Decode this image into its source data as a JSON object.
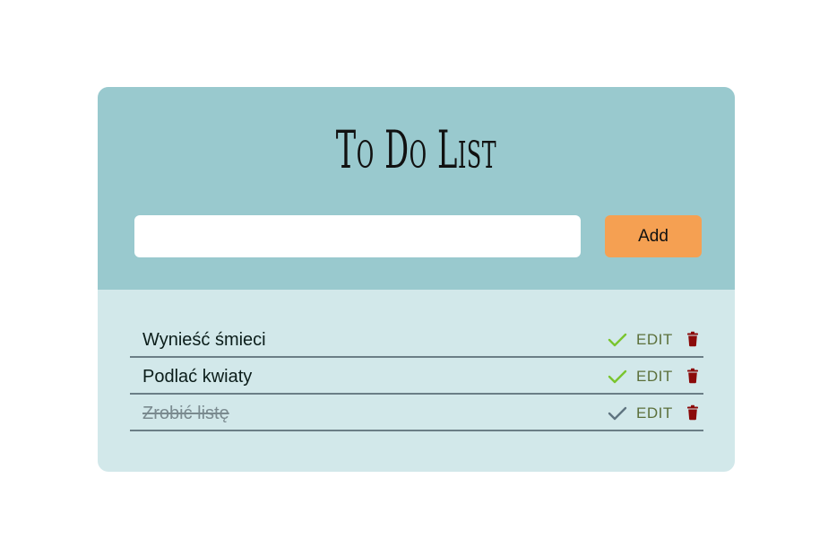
{
  "header": {
    "title": "To Do List"
  },
  "new_task": {
    "value": "",
    "placeholder": ""
  },
  "add_button": {
    "label": "Add"
  },
  "colors": {
    "header_bg": "#99c9ce",
    "list_bg": "#d2e8ea",
    "add_button_bg": "#f5a052",
    "check_active": "#7ac52e",
    "check_done": "#5f7480",
    "trash": "#8b0a0a",
    "edit_text": "#5b6f3a"
  },
  "tasks": [
    {
      "text": "Wynieść śmieci",
      "done": false,
      "edit_label": "EDIT",
      "check_icon": "check-icon",
      "delete_icon": "trash-icon"
    },
    {
      "text": "Podlać kwiaty",
      "done": false,
      "edit_label": "EDIT",
      "check_icon": "check-icon",
      "delete_icon": "trash-icon"
    },
    {
      "text": "Zrobić listę",
      "done": true,
      "edit_label": "EDIT",
      "check_icon": "check-icon",
      "delete_icon": "trash-icon"
    }
  ]
}
